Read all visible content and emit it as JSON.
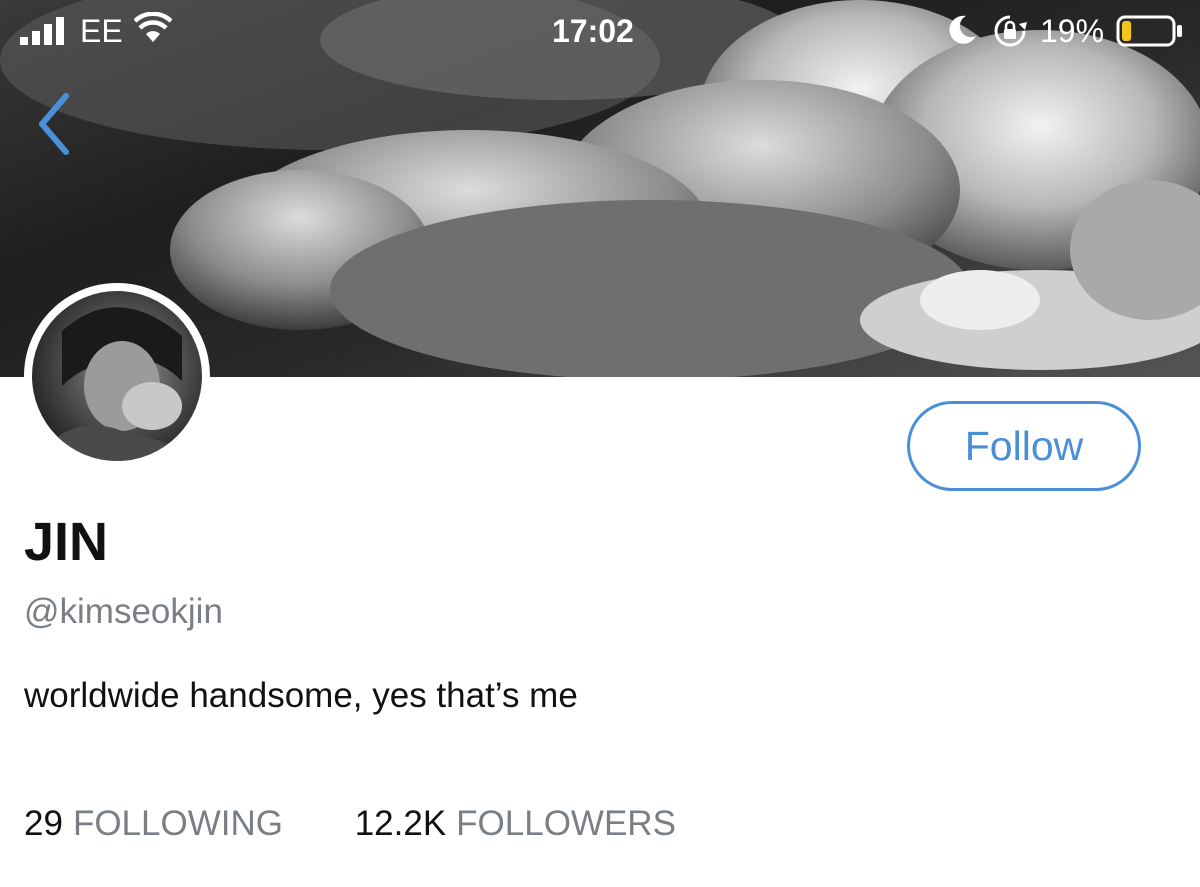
{
  "status_bar": {
    "carrier": "EE",
    "time": "17:02",
    "battery_percent": "19%",
    "battery_level": 0.19,
    "icons": [
      "signal-bars-icon",
      "wifi-icon",
      "moon-icon",
      "rotation-lock-icon",
      "battery-icon"
    ]
  },
  "nav": {
    "back_icon": "chevron-left-icon"
  },
  "profile": {
    "display_name": "JIN",
    "handle": "@kimseokjin",
    "bio": "worldwide handsome, yes that’s me",
    "follow_label": "Follow",
    "following_count": "29",
    "following_label": "FOLLOWING",
    "followers_count": "12.2K",
    "followers_label": "FOLLOWERS"
  },
  "colors": {
    "accent": "#4a90d9",
    "muted_text": "#7a7f85",
    "battery_low": "#f5c518"
  }
}
